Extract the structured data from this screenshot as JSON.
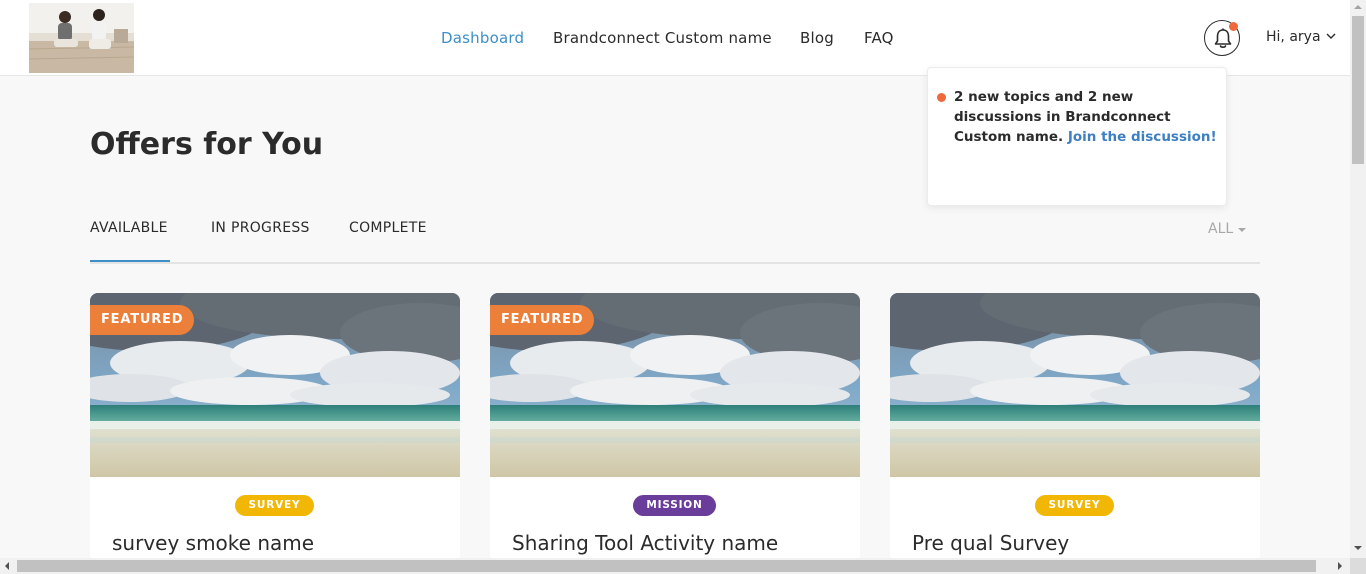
{
  "nav": {
    "items": [
      {
        "label": "Dashboard",
        "active": true
      },
      {
        "label": "Brandconnect Custom name",
        "active": false
      },
      {
        "label": "Blog",
        "active": false
      },
      {
        "label": "FAQ",
        "active": false
      }
    ]
  },
  "user": {
    "greeting": "Hi, arya",
    "notification_icon": "bell-icon",
    "has_unread": true
  },
  "notification": {
    "text": "2 new topics and 2 new discussions in Brandconnect Custom name.",
    "link": "Join the discussion!"
  },
  "page": {
    "title": "Offers for You"
  },
  "tabs": [
    {
      "label": "AVAILABLE",
      "active": true
    },
    {
      "label": "IN PROGRESS",
      "active": false
    },
    {
      "label": "COMPLETE",
      "active": false
    }
  ],
  "filter": {
    "label": "ALL"
  },
  "cards": [
    {
      "featured_label": "FEATURED",
      "type": "SURVEY",
      "title": "survey smoke name"
    },
    {
      "featured_label": "FEATURED",
      "type": "MISSION",
      "title": "Sharing Tool Activity name"
    },
    {
      "featured_label": "",
      "type": "SURVEY",
      "title": "Pre qual Survey"
    }
  ],
  "colors": {
    "accent": "#3d8fc6",
    "featured": "#ec7f3a",
    "survey": "#f2b705",
    "mission": "#6a3d9a",
    "notification_dot": "#ef6a3a"
  }
}
